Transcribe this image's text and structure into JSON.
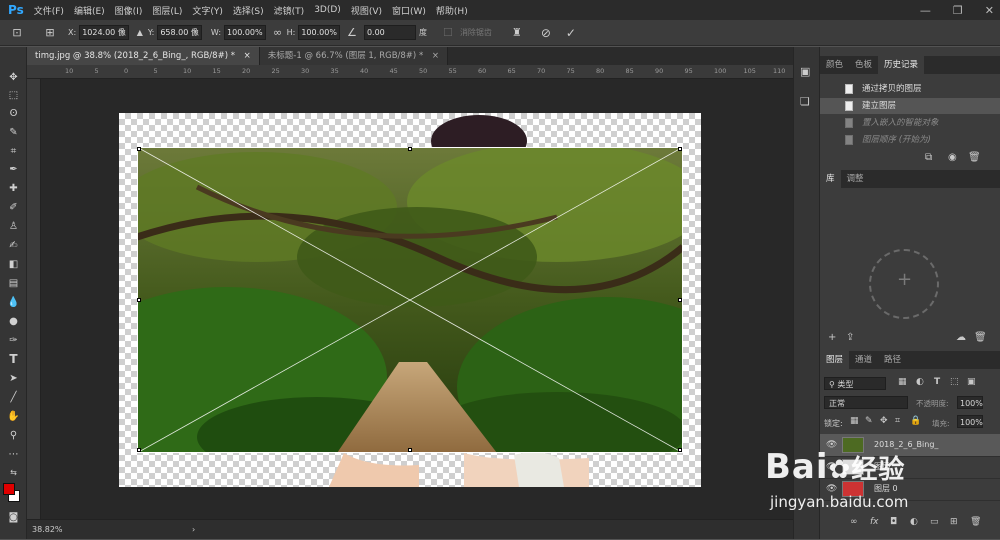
{
  "app": {
    "logo": "Ps"
  },
  "menu": [
    "文件(F)",
    "编辑(E)",
    "图像(I)",
    "图层(L)",
    "文字(Y)",
    "选择(S)",
    "滤镜(T)",
    "3D(D)",
    "视图(V)",
    "窗口(W)",
    "帮助(H)"
  ],
  "options": {
    "x_label": "X:",
    "x_value": "1024.00 像",
    "y_label": "Y:",
    "y_value": "658.00 像",
    "w_label": "W:",
    "w_value": "100.00%",
    "h_label": "H:",
    "h_value": "100.00%",
    "angle_value": "0.00",
    "angle_unit": "度",
    "interp_label": "插值",
    "mode_label": "消除锯齿"
  },
  "tabs": [
    {
      "label": "timg.jpg @ 38.8% (2018_2_6_Bing_, RGB/8#) *",
      "close": "×"
    },
    {
      "label": "未标题-1 @ 66.7% (图层 1, RGB/8#) *",
      "close": "×"
    }
  ],
  "ruler_ticks": [
    "10",
    "5",
    "0",
    "5",
    "10",
    "15",
    "20",
    "25",
    "30",
    "35",
    "40",
    "45",
    "50",
    "55",
    "60",
    "65",
    "70",
    "75",
    "80",
    "85",
    "90",
    "95",
    "100",
    "105",
    "110"
  ],
  "status": {
    "zoom": "38.82%",
    "arrow": "›"
  },
  "panels": {
    "top_tabs": [
      "颜色",
      "色板",
      "历史记录"
    ],
    "history": [
      {
        "label": "通过拷贝的图层",
        "dim": false
      },
      {
        "label": "建立图层",
        "dim": false
      },
      {
        "label": "置入嵌入的智能对象",
        "dim": true
      },
      {
        "label": "图层顺序 (开始为)",
        "dim": true
      }
    ],
    "mid_tabs": [
      "库",
      "调整"
    ],
    "layer_tabs": [
      "图层",
      "通道",
      "路径"
    ],
    "layer_filter": "类型",
    "blend_mode": "正常",
    "opacity_label": "不透明度:",
    "opacity_value": "100%",
    "lock_label": "锁定:",
    "fill_label": "填充:",
    "fill_value": "100%",
    "layers": [
      {
        "name": "2018_2_6_Bing_",
        "selected": true
      },
      {
        "name": "图层",
        "selected": false
      },
      {
        "name": "图层 0",
        "selected": false
      }
    ]
  },
  "colors": {
    "foreground": "#e00000",
    "background": "#ffffff",
    "accent": "#31a8ff"
  },
  "watermark": {
    "brand": "Bai",
    "brand_after": "经验",
    "url": "jingyan.baidu.com"
  }
}
